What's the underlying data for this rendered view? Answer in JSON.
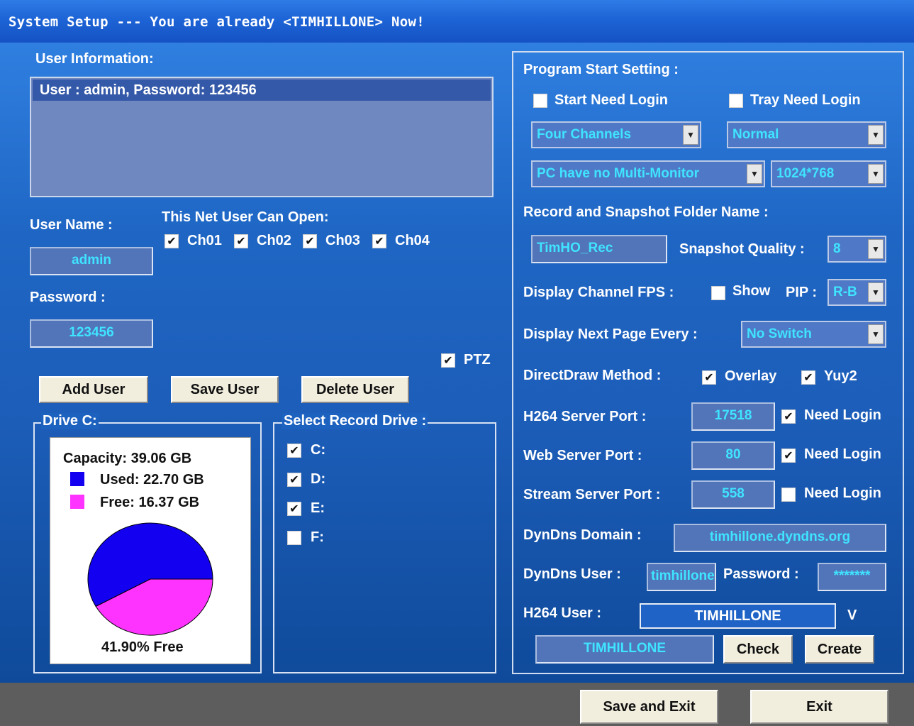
{
  "title": "System Setup --- You are already <TIMHILLONE> Now!",
  "colors": {
    "used": "#1400f0",
    "free": "#ff33ff",
    "accent_text": "#3fe4ff"
  },
  "user_info": {
    "heading": "User Information:",
    "list": [
      "User : admin, Password: 123456"
    ]
  },
  "user_name": {
    "label": "User Name :",
    "value": "admin"
  },
  "password": {
    "label": "Password :",
    "value": "123456"
  },
  "net_open": {
    "label": "This Net User Can Open:",
    "channels": [
      {
        "label": "Ch01",
        "checked": true
      },
      {
        "label": "Ch02",
        "checked": true
      },
      {
        "label": "Ch03",
        "checked": true
      },
      {
        "label": "Ch04",
        "checked": true
      }
    ]
  },
  "ptz": {
    "label": "PTZ",
    "checked": true
  },
  "buttons": {
    "add_user": "Add User",
    "save_user": "Save User",
    "delete_user": "Delete User"
  },
  "drive": {
    "legend": "Drive C:",
    "capacity": "Capacity: 39.06 GB",
    "used": "Used: 22.70 GB",
    "free": "Free: 16.37 GB",
    "free_pct_text": "41.90% Free",
    "free_fraction": 0.419
  },
  "record_drive": {
    "legend": "Select Record Drive :",
    "drives": [
      {
        "label": "C:",
        "checked": true
      },
      {
        "label": "D:",
        "checked": true
      },
      {
        "label": "E:",
        "checked": true
      },
      {
        "label": "F:",
        "checked": false
      }
    ]
  },
  "program_start": {
    "heading": "Program Start Setting :",
    "start_need_login": {
      "label": "Start Need Login",
      "checked": false
    },
    "tray_need_login": {
      "label": "Tray Need Login",
      "checked": false
    },
    "channels_select": "Four Channels",
    "mode_select": "Normal",
    "monitor_select": "PC have no Multi-Monitor",
    "resolution_select": "1024*768"
  },
  "record": {
    "label": "Record and Snapshot Folder Name :",
    "folder": "TimHO_Rec",
    "quality_label": "Snapshot Quality :",
    "quality": "8"
  },
  "fps": {
    "label": "Display Channel FPS :",
    "show_label": "Show",
    "show_checked": false,
    "pip_label": "PIP :",
    "pip": "R-B"
  },
  "next_page": {
    "label": "Display Next Page Every :",
    "value": "No Switch"
  },
  "directdraw": {
    "label": "DirectDraw Method :",
    "overlay": {
      "label": "Overlay",
      "checked": true
    },
    "yuy2": {
      "label": "Yuy2",
      "checked": true
    }
  },
  "ports": [
    {
      "label": "H264 Server Port :",
      "value": "17518",
      "need_login_label": "Need Login",
      "checked": true
    },
    {
      "label": "Web Server Port :",
      "value": "80",
      "need_login_label": "Need Login",
      "checked": true
    },
    {
      "label": "Stream Server Port :",
      "value": "558",
      "need_login_label": "Need Login",
      "checked": false
    }
  ],
  "dyndns": {
    "domain_label": "DynDns Domain :",
    "domain": "timhillone.dyndns.org",
    "user_label": "DynDns User :",
    "user": "timhillone",
    "password_label": "Password :",
    "password": "*******"
  },
  "h264_user": {
    "label": "H264 User :",
    "value": "TIMHILLONE",
    "v_label": "V",
    "code": "TIMHILLONE",
    "check_label": "Check",
    "create_label": "Create"
  },
  "footer": {
    "save_exit": "Save and Exit",
    "exit": "Exit"
  }
}
